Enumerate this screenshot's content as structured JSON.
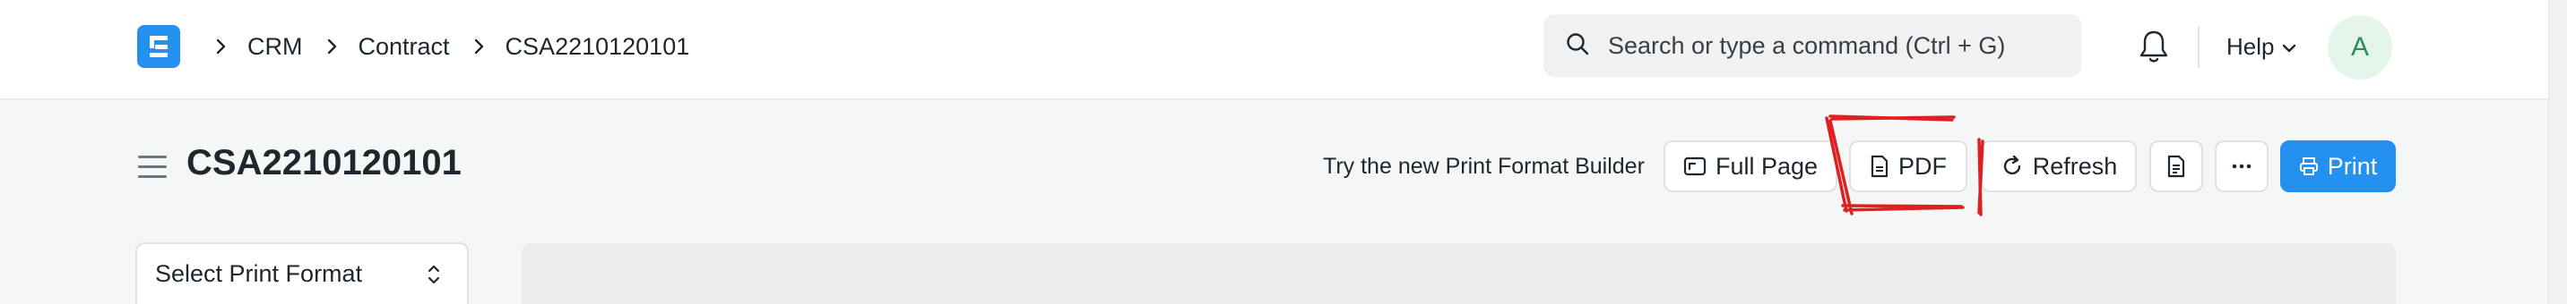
{
  "navbar": {
    "logo_icon": "frappe-e-logo",
    "breadcrumbs": [
      "CRM",
      "Contract",
      "CSA2210120101"
    ],
    "search": {
      "placeholder": "Search or type a command (Ctrl + G)",
      "value": ""
    },
    "help_label": "Help",
    "avatar_initial": "A"
  },
  "page": {
    "title": "CSA2210120101",
    "print_format_builder_link": "Try the new Print Format Builder"
  },
  "toolbar": {
    "full_page_label": "Full Page",
    "pdf_label": "PDF",
    "refresh_label": "Refresh",
    "print_label": "Print",
    "more_icon": "ellipsis-icon"
  },
  "sidebar": {
    "select_print_format": "Select Print Format"
  },
  "colors": {
    "accent": "#2490ef",
    "annotation": "#e02020",
    "avatar_bg": "#e4f5e9",
    "avatar_text": "#2e8b57"
  }
}
